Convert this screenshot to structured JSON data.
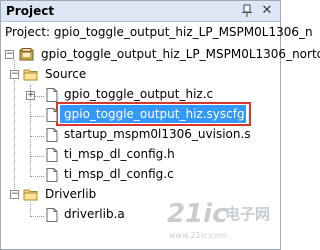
{
  "panel": {
    "title": "Project",
    "project_label": "Project: gpio_toggle_output_hiz_LP_MSPM0L1306_n",
    "target_label": "gpio_toggle_output_hiz_LP_MSPM0L1306_norto"
  },
  "tree": {
    "source_folder": "Source",
    "files": [
      "gpio_toggle_output_hiz.c",
      "gpio_toggle_output_hiz.syscfg",
      "startup_mspm0l1306_uvision.s",
      "ti_msp_dl_config.h",
      "ti_msp_dl_config.c"
    ],
    "driverlib_folder": "Driverlib",
    "driverlib_files": [
      "driverlib.a"
    ]
  },
  "selection": {
    "selected_file": "gpio_toggle_output_hiz.syscfg",
    "highlight_color": "#3399ff",
    "box_color": "#d8362c"
  },
  "watermark": {
    "brand": "21ic",
    "cn": "电子网",
    "en": "www.21ic.com"
  },
  "icons": [
    "pin-icon",
    "close-icon",
    "target-icon",
    "folder-icon",
    "file-icon",
    "expand-plus-icon",
    "collapse-minus-icon"
  ]
}
